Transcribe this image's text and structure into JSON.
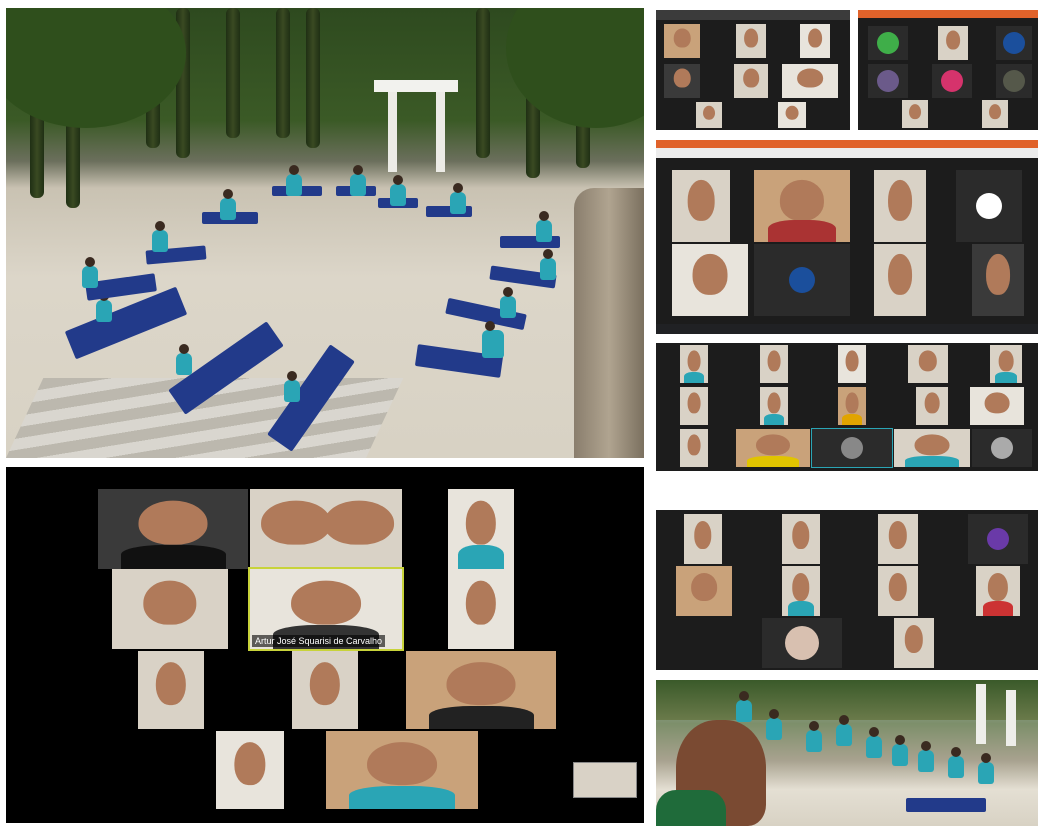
{
  "zoom_call": {
    "active_speaker_label": "Artur José Squarisi de Carvalho"
  },
  "colors": {
    "shirt": "#2aa5b5",
    "mat": "#223a8a",
    "active_speaker_border": "#c8d33a",
    "browser_tab_accent": "#e0622a"
  }
}
